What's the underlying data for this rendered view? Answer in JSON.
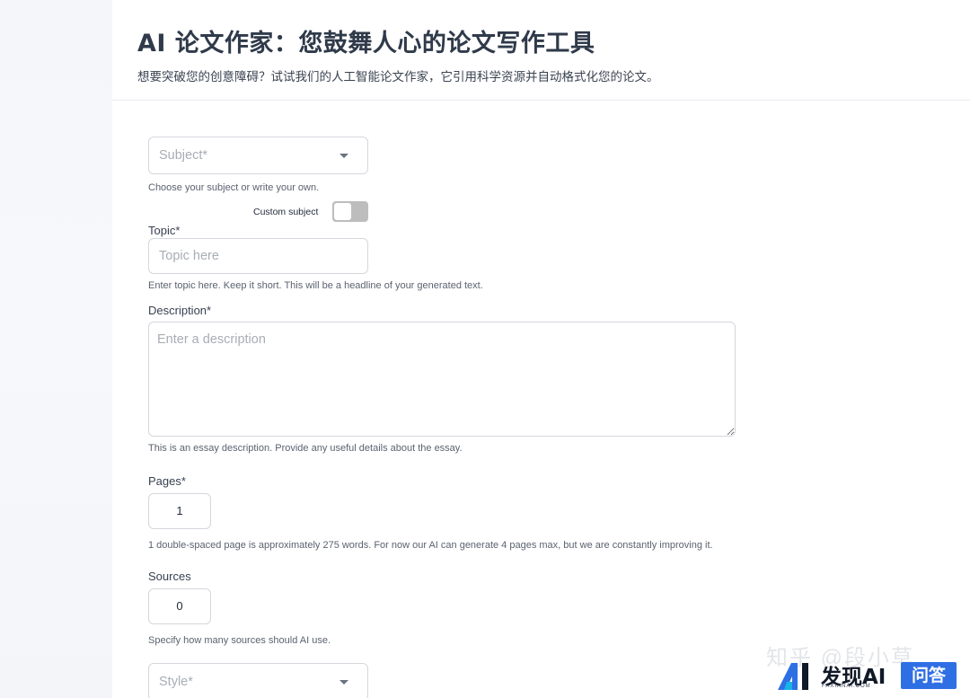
{
  "header": {
    "title": "AI 论文作家：您鼓舞人心的论文写作工具",
    "subtitle": "想要突破您的创意障碍？试试我们的人工智能论文作家，它引用科学资源并自动格式化您的论文。"
  },
  "form": {
    "subject": {
      "placeholder": "Subject*",
      "help": "Choose your subject or write your own.",
      "custom_label": "Custom subject",
      "custom_enabled": false
    },
    "topic": {
      "label": "Topic*",
      "placeholder": "Topic here",
      "help": "Enter topic here. Keep it short. This will be a headline of your generated text."
    },
    "description": {
      "label": "Description*",
      "placeholder": "Enter a description",
      "help": "This is an essay description. Provide any useful details about the essay."
    },
    "pages": {
      "label": "Pages*",
      "value": "1",
      "help": "1 double-spaced page is approximately 275 words. For now our AI can generate 4 pages max, but we are constantly improving it."
    },
    "sources": {
      "label": "Sources",
      "value": "0",
      "help": "Specify how many sources should AI use."
    },
    "style": {
      "placeholder": "Style*"
    }
  },
  "overlay": {
    "watermark": "知乎 @段小草",
    "brand_name": "发现AI",
    "brand_domain": "FAXIANAI.COM",
    "brand_badge": "问答"
  },
  "colors": {
    "title": "#2f3a4a",
    "border": "#d4d7dc",
    "placeholder": "#a8adb5",
    "toggle_off": "#bdbdbd",
    "brand_badge": "#2f6fe4"
  },
  "icons": [
    "chevron-down-icon",
    "toggle-switch",
    "resize-handle-icon",
    "faxianai-logo-icon"
  ]
}
